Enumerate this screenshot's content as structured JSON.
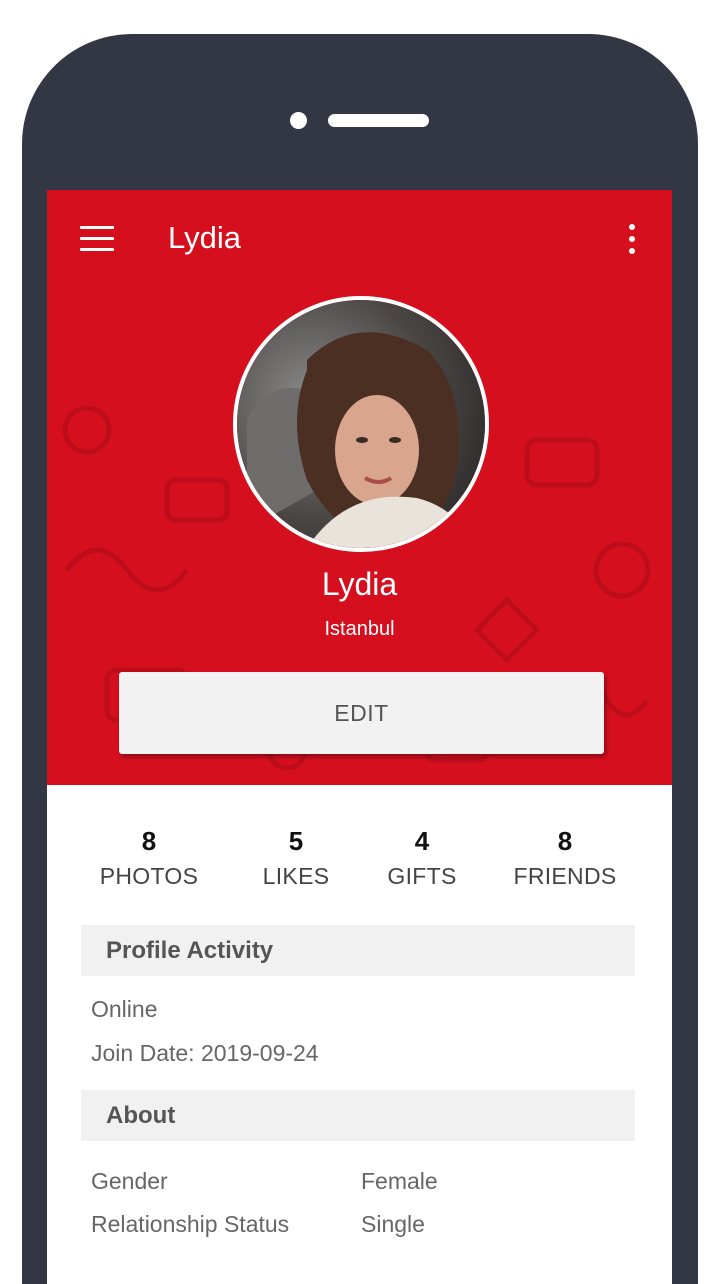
{
  "app_bar": {
    "title": "Lydia",
    "menu_icon": "hamburger-menu-icon",
    "more_icon": "more-vertical-icon"
  },
  "profile": {
    "name": "Lydia",
    "city": "Istanbul",
    "edit_label": "EDIT"
  },
  "stats": [
    {
      "value": "8",
      "label": "PHOTOS"
    },
    {
      "value": "5",
      "label": "LIKES"
    },
    {
      "value": "4",
      "label": "GIFTS"
    },
    {
      "value": "8",
      "label": "FRIENDS"
    }
  ],
  "activity": {
    "header": "Profile Activity",
    "status": "Online",
    "join_date": "Join Date: 2019-09-24"
  },
  "about": {
    "header": "About",
    "rows": [
      {
        "label": "Gender",
        "value": "Female"
      },
      {
        "label": "Relationship Status",
        "value": "Single"
      }
    ]
  },
  "colors": {
    "brand_red": "#d50f1e",
    "phone_frame": "#333744"
  }
}
